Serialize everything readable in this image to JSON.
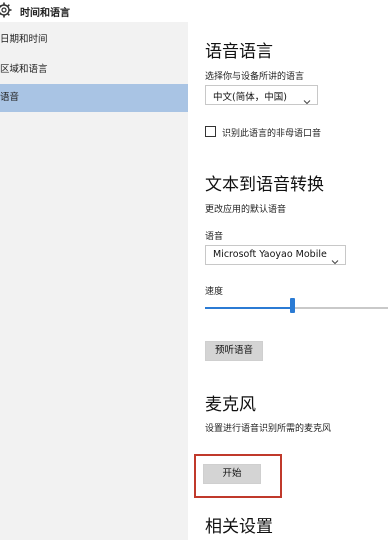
{
  "window": {
    "title": "时间和语言"
  },
  "sidebar": {
    "items": [
      {
        "label": "日期和时间"
      },
      {
        "label": "区域和语言"
      },
      {
        "label": "语音"
      }
    ]
  },
  "speech_language": {
    "heading": "语音语言",
    "select_label": "选择你与设备所讲的语言",
    "selected": "中文(简体，中国)",
    "checkbox_label": "识别此语言的非母语口音",
    "checkbox_checked": false
  },
  "tts": {
    "heading": "文本到语音转换",
    "description": "更改应用的默认语音",
    "voice_label": "语音",
    "voice_selected": "Microsoft Yaoyao Mobile",
    "speed_label": "速度",
    "speed_value_fraction": 0.48,
    "preview_button": "预听语音"
  },
  "microphone": {
    "heading": "麦克风",
    "description": "设置进行语音识别所需的麦克风",
    "start_button": "开始"
  },
  "related": {
    "heading": "相关设置"
  },
  "colors": {
    "accent": "#2b7bd4",
    "selected_nav": "#a9c4e4",
    "highlight_box": "#c0392b"
  }
}
